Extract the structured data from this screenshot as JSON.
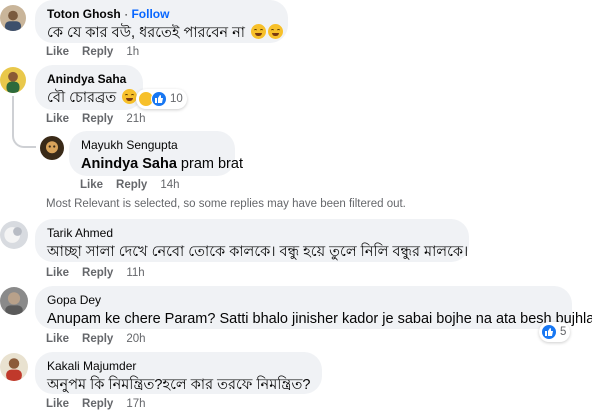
{
  "comments": [
    {
      "author": "Toton Ghosh",
      "follow_label": "Follow",
      "text": "কে যে কার বউ, ধরতেই পারবেন না",
      "like": "Like",
      "reply": "Reply",
      "time": "1h"
    },
    {
      "author": "Anindya Saha",
      "text": "বৌ চোরব্রত",
      "reaction_count": "10",
      "like": "Like",
      "reply": "Reply",
      "time": "21h"
    },
    {
      "author": "Mayukh Sengupta",
      "mention": "Anindya Saha",
      "text": "pram brat",
      "like": "Like",
      "reply": "Reply",
      "time": "14h"
    },
    {
      "author": "Tarik Ahmed",
      "text": "আচ্ছা সালা দেখে নেবো তোকে কালকে। বন্ধু হয়ে তুলে নিলি বন্ধুর মালকে।",
      "like": "Like",
      "reply": "Reply",
      "time": "11h"
    },
    {
      "author": "Gopa Dey",
      "text": "Anupam ke chere Param? Satti bhalo jinisher kador je sabai bojhe na ata besh bujhlam.",
      "reaction_count": "5",
      "like": "Like",
      "reply": "Reply",
      "time": "20h"
    },
    {
      "author": "Kakali Majumder",
      "text": "অনুপম কি নিমন্ত্রিত?হলে কার তরফে নিমন্ত্রিত?",
      "like": "Like",
      "reply": "Reply",
      "time": "17h"
    }
  ],
  "filter_note": "Most Relevant is selected, so some replies may have been filtered out.",
  "colors": {
    "bubble": "#f0f2f5",
    "accent": "#0866ff",
    "meta": "#65676b"
  }
}
